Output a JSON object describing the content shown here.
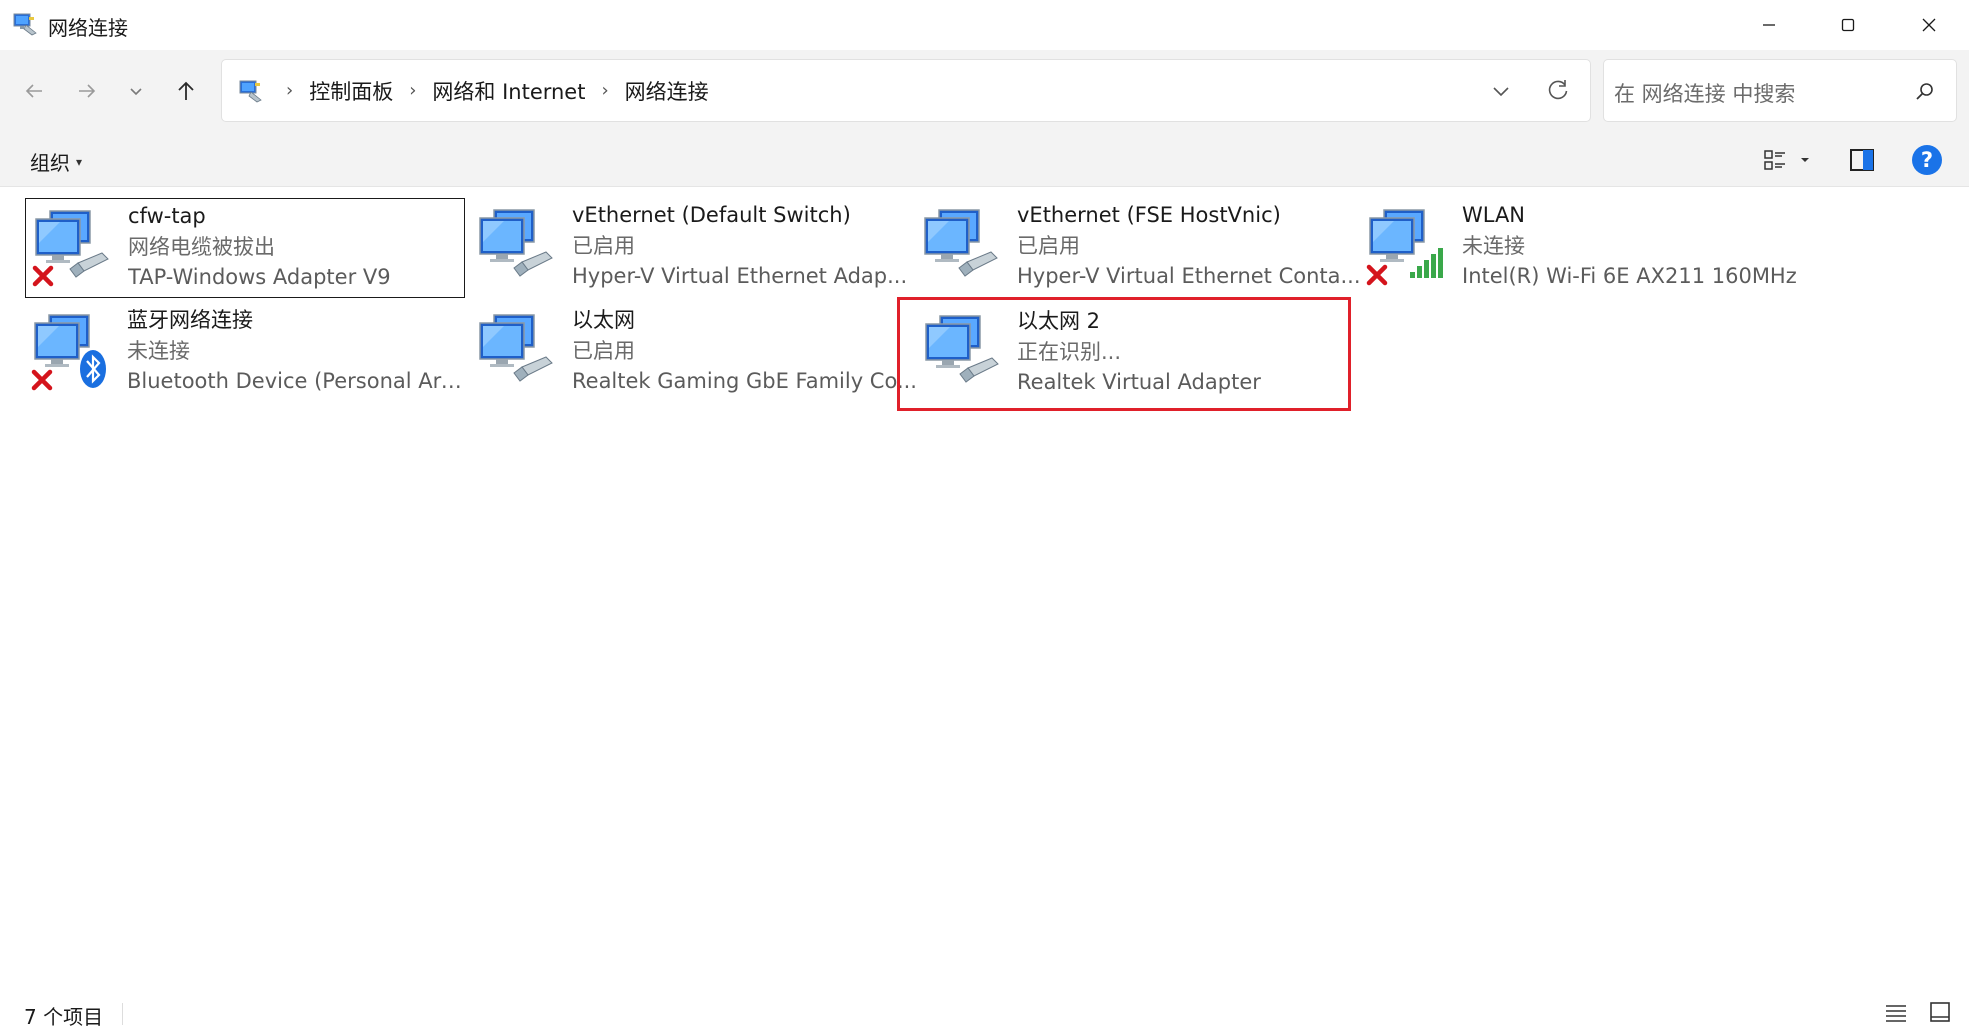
{
  "window": {
    "title": "网络连接",
    "app_icon": "network-connections-icon",
    "controls": [
      "minimize-icon",
      "maximize-icon",
      "close-icon"
    ]
  },
  "nav": {
    "back_icon": "arrow-left-icon",
    "forward_icon": "arrow-right-icon",
    "recent_icon": "chevron-down-icon",
    "up_icon": "arrow-up-icon"
  },
  "address": {
    "icon": "network-folder-icon",
    "crumbs": [
      {
        "label": "控制面板"
      },
      {
        "label": "网络和 Internet"
      },
      {
        "label": "网络连接"
      }
    ],
    "separator": "›"
  },
  "search": {
    "placeholder": "在 网络连接 中搜索"
  },
  "toolbar": {
    "organize_label": "组织",
    "organize_caret": "▾",
    "help_label": "?"
  },
  "connections": [
    {
      "name": "cfw-tap",
      "status": "网络电缆被拔出",
      "device": "TAP-Windows Adapter V9",
      "badge": "red-x",
      "type": "ethernet"
    },
    {
      "name": "vEthernet (Default Switch)",
      "status": "已启用",
      "device": "Hyper-V Virtual Ethernet Adap...",
      "badge": "none",
      "type": "ethernet"
    },
    {
      "name": "vEthernet (FSE HostVnic)",
      "status": "已启用",
      "device": "Hyper-V Virtual Ethernet Conta...",
      "badge": "none",
      "type": "ethernet"
    },
    {
      "name": "WLAN",
      "status": "未连接",
      "device": "Intel(R) Wi-Fi 6E AX211 160MHz",
      "badge": "red-x",
      "type": "wifi"
    },
    {
      "name": "蓝牙网络连接",
      "status": "未连接",
      "device": "Bluetooth Device (Personal Are...",
      "badge": "red-x",
      "type": "bluetooth"
    },
    {
      "name": "以太网",
      "status": "已启用",
      "device": "Realtek Gaming GbE Family Co...",
      "badge": "none",
      "type": "ethernet"
    },
    {
      "name": "以太网 2",
      "status": "正在识别...",
      "device": "Realtek Virtual Adapter",
      "badge": "none",
      "type": "ethernet"
    }
  ],
  "statusbar": {
    "count_label": "7 个项目"
  },
  "colors": {
    "highlight": "#e0202a",
    "accent": "#1a73e8",
    "chrome": "#f3f3f3"
  }
}
